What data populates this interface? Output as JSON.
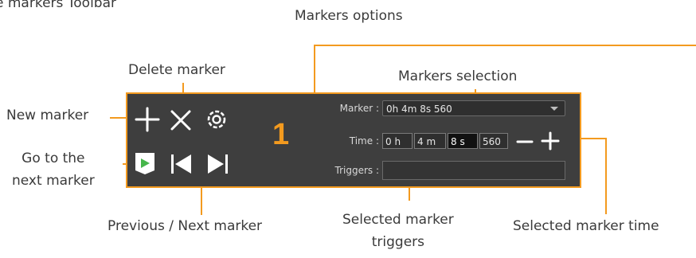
{
  "callouts": {
    "toolbar_title": "e markers Toolbar",
    "markers_options": "Markers options",
    "delete_marker": "Delete marker",
    "markers_selection": "Markers selection",
    "new_marker": "New marker",
    "go_next_line1": "Go to the",
    "go_next_line2": "next marker",
    "prev_next_marker": "Previous / Next marker",
    "selected_triggers_line1": "Selected marker",
    "selected_triggers_line2": "triggers",
    "selected_time": "Selected marker time"
  },
  "toolbar": {
    "region_number": "1",
    "marker_label": "Marker :",
    "marker_value": "0h 4m 8s 560",
    "time_label": "Time :",
    "time_h": "0 h",
    "time_m": "4 m",
    "time_s": "8 s",
    "time_ms": "560",
    "minus": "−",
    "plus": "+",
    "triggers_label": "Triggers :",
    "triggers_value": ""
  },
  "icons": [
    "plus-icon",
    "close-icon",
    "gear-icon",
    "play-flag-icon",
    "skip-previous-icon",
    "skip-next-icon",
    "minus-icon",
    "plus-icon"
  ],
  "colors": {
    "accent": "#f39a1f",
    "panel": "#3e3e3e",
    "play": "#46b64b"
  }
}
